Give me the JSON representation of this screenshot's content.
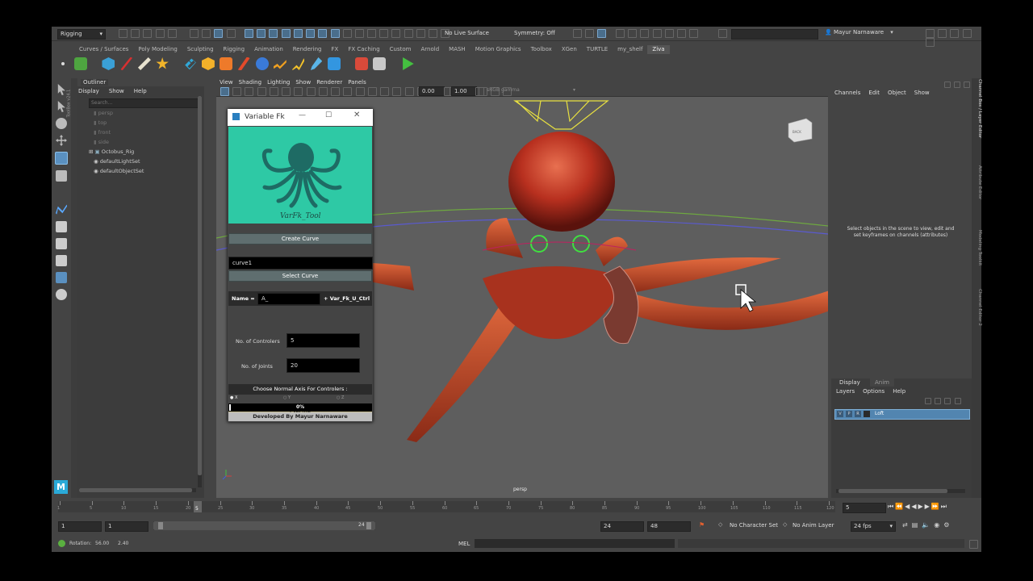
{
  "menubar": {
    "mode_menu": "Rigging",
    "surface_field": "No Live Surface",
    "symmetry_field": "Symmetry: Off",
    "user_name": "Mayur Narnaware"
  },
  "shelf_tabs": [
    "Curves / Surfaces",
    "Poly Modeling",
    "Sculpting",
    "Rigging",
    "Animation",
    "Rendering",
    "FX",
    "FX Caching",
    "Custom",
    "Arnold",
    "MASH",
    "Motion Graphics",
    "Toolbox",
    "XGen",
    "TURTLE",
    "my_shelf",
    "Ziva"
  ],
  "shelf_active_index": 16,
  "outliner": {
    "title": "Outliner",
    "menu": [
      "Display",
      "Show",
      "Help"
    ],
    "search_placeholder": "Search...",
    "items": [
      "persp",
      "top",
      "front",
      "side",
      "Octobus_Rig",
      "defaultLightSet",
      "defaultObjectSet"
    ]
  },
  "viewport": {
    "menu": [
      "View",
      "Shading",
      "Lighting",
      "Show",
      "Renderer",
      "Panels"
    ],
    "field_a": "0.00",
    "field_b": "1.00",
    "color_space": "sRGB gamma",
    "camera_label": "persp",
    "view_cube_label": "BACK",
    "side_label": "ToolBox v24.1"
  },
  "varfk": {
    "window_title": "Variable Fk",
    "logo_text": "VarFk_Tool",
    "create_curve": "Create Curve",
    "curve_value": "curve1",
    "select_curve": "Select Curve",
    "name_label": "Name =",
    "name_value": "A_",
    "name_suffix": "+ Var_Fk_U_Ctrl",
    "controllers_label": "No. of Controlers",
    "controllers_value": "5",
    "joints_label": "No. of Joints",
    "joints_value": "20",
    "axis_header": "Choose Normal Axis For Controlers :",
    "axes": [
      "X",
      "Y",
      "Z"
    ],
    "selected_axis": "X",
    "execute": "Execute",
    "progress_text": "0%",
    "progress": 0,
    "credit": "Developed By Mayur Narnaware"
  },
  "channel_box": {
    "menu": [
      "Channels",
      "Edit",
      "Object",
      "Show"
    ],
    "hint": "Select objects in the scene to view, edit and set keyframes on channels (attributes)",
    "side_tabs": [
      "Channel Box / Layer Editor",
      "Attribute Editor",
      "Modeling Toolkit",
      "Channel Editor 2"
    ]
  },
  "layer_editor": {
    "tabs": [
      "Display",
      "Anim"
    ],
    "active_tab": "Display",
    "menu": [
      "Layers",
      "Options",
      "Help"
    ],
    "flags": [
      "V",
      "P",
      "R"
    ],
    "layer_name": "Loft"
  },
  "timeline": {
    "ticks": [
      "1",
      "5",
      "10",
      "15",
      "20",
      "25",
      "30",
      "35",
      "40",
      "45",
      "50",
      "55",
      "60",
      "65",
      "70",
      "75",
      "80",
      "85",
      "90",
      "95",
      "100",
      "105",
      "110",
      "115",
      "120"
    ],
    "current_frame": "5",
    "frame_field": "5"
  },
  "range": {
    "start": "1",
    "start2": "1",
    "range_end_label": "24",
    "end": "24",
    "end2": "48",
    "character_set": "No Character Set",
    "anim_layer": "No Anim Layer",
    "fps": "24 fps"
  },
  "status": {
    "label": "Rotation:",
    "value1": "56.00",
    "value2": "2.40",
    "mel": "MEL"
  },
  "colors": {
    "teal": "#2ec9a5",
    "octo_red": "#c8472e",
    "accent_blue": "#5286b2"
  }
}
